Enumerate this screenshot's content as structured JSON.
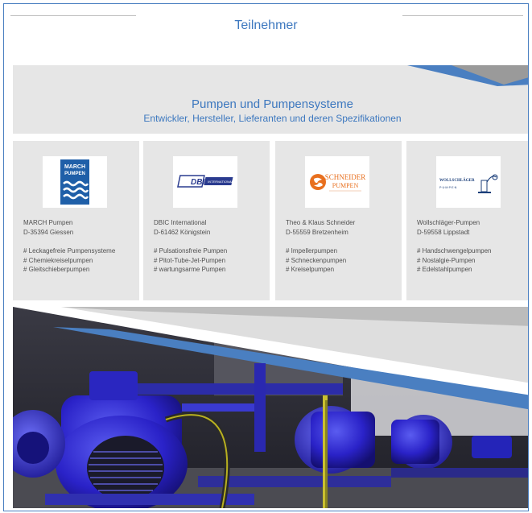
{
  "header": {
    "title": "Teilnehmer"
  },
  "banner": {
    "title": "Pumpen und Pumpensysteme",
    "subtitle": "Entwickler, Hersteller, Lieferanten und deren Spezifikationen"
  },
  "cards": [
    {
      "logo": {
        "line1": "MARCH",
        "line2": "PUMPEN"
      },
      "name": "MARCH Pumpen",
      "city": "D-35394 Giessen",
      "tags": [
        "# Leckagefreie Pumpensysteme",
        "# Chemiekreiselpumpen",
        "# Gleitschieberpumpen"
      ]
    },
    {
      "logo": {
        "line1": "DBIC",
        "line2": "INTERNATIONAL"
      },
      "name": "DBIC International",
      "city": "D-61462 Königstein",
      "tags": [
        "# Pulsationsfreie Pumpen",
        "# Pitot-Tube-Jet-Pumpen",
        "# wartungsarme Pumpen"
      ]
    },
    {
      "logo": {
        "line1": "SCHNEIDER",
        "line2": "PUMPEN"
      },
      "name": "Theo & Klaus Schneider",
      "city": "D-55559 Bretzenheim",
      "tags": [
        "# Impellerpumpen",
        "# Schneckenpumpen",
        "# Kreiselpumpen"
      ]
    },
    {
      "logo": {
        "line1": "WOLLSCHLÄGER",
        "line2": "P·U·M·P·E·N"
      },
      "name": "Wollschläger-Pumpen",
      "city": "D-59558 Lippstadt",
      "tags": [
        "# Handschwengelpumpen",
        "# Nostalgie-Pumpen",
        "# Edelstahlpumpen"
      ]
    }
  ],
  "colors": {
    "accent": "#3d78bf",
    "panel": "#e6e6e6",
    "march": "#1f5fa8",
    "schneider": "#e8701f"
  },
  "photo": {
    "icon": "pump-machinery-photo"
  }
}
